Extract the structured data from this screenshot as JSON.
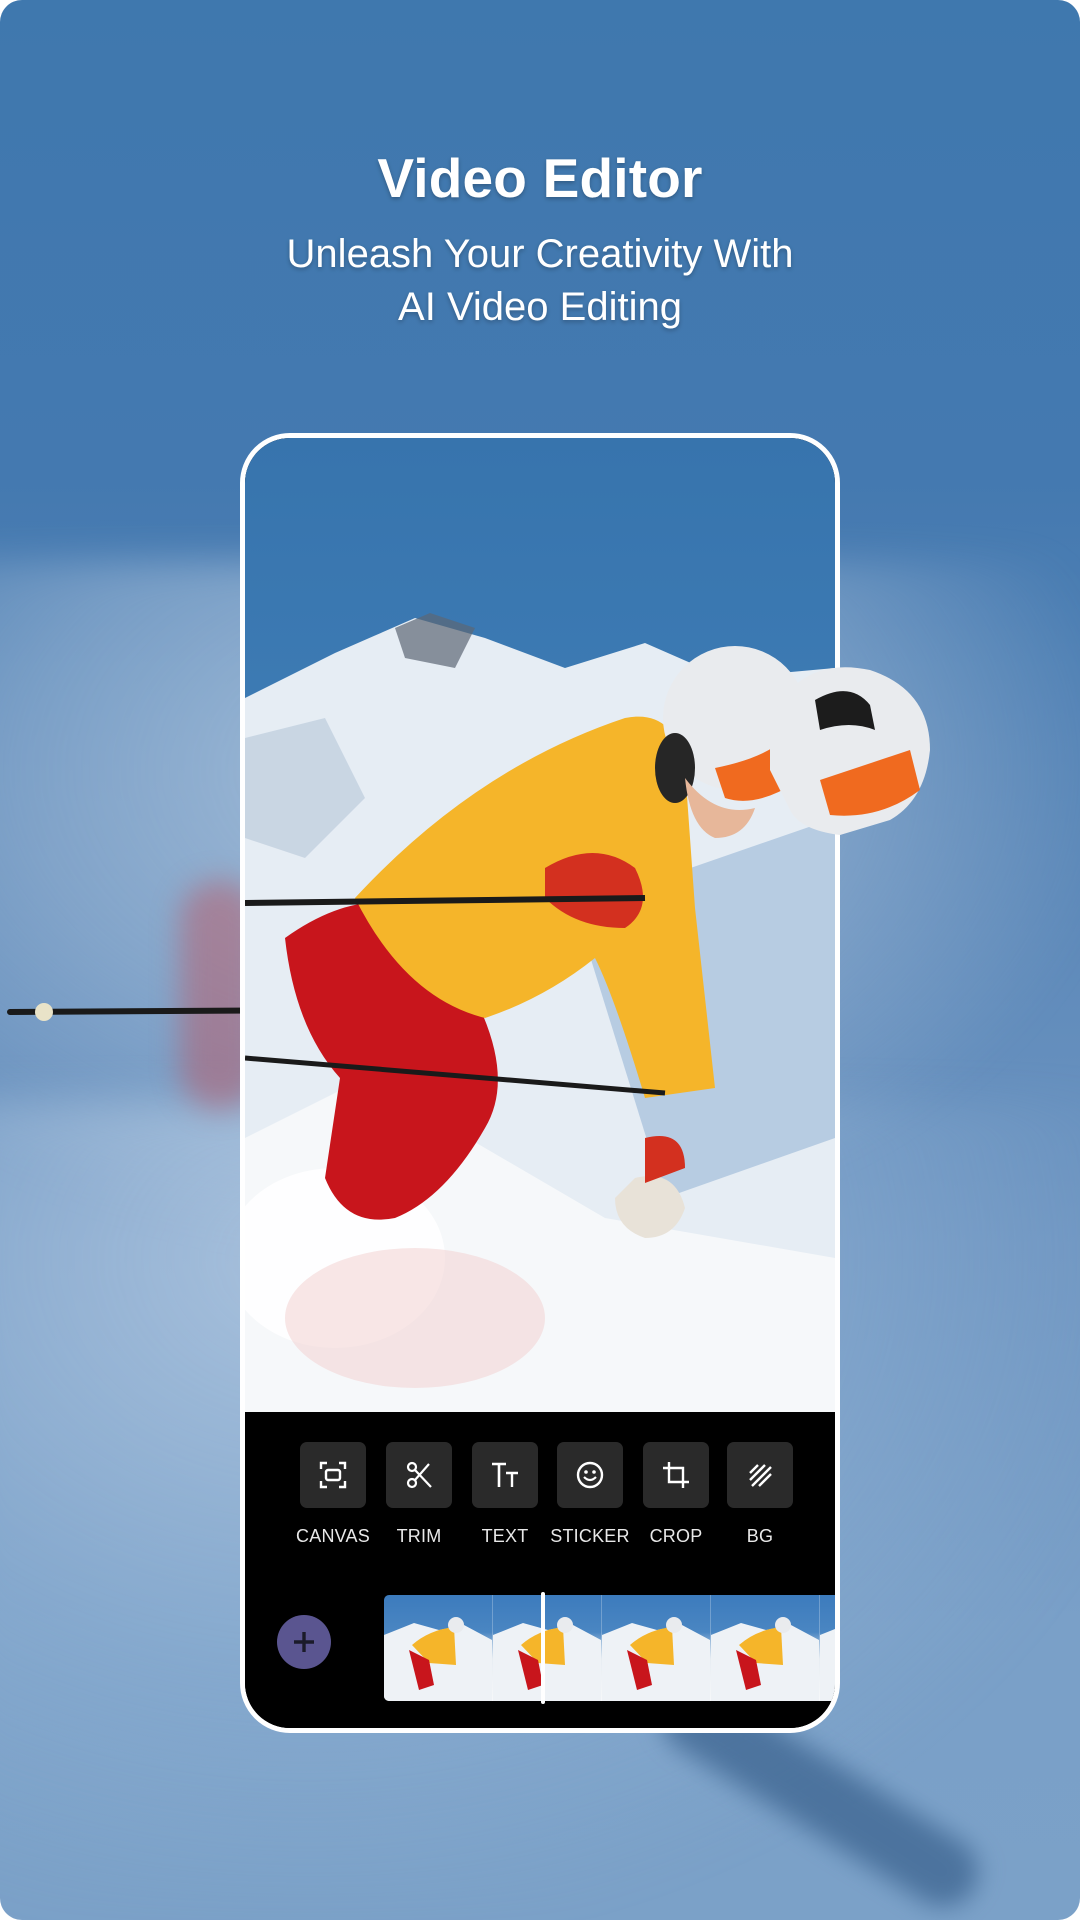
{
  "header": {
    "title": "Video Editor",
    "subtitle_line1": "Unleash Your Creativity With",
    "subtitle_line2": "AI Video Editing"
  },
  "editor": {
    "preview_subject": "skier in yellow jacket and red pants descending snowy slope",
    "tools": [
      {
        "label": "CANVAS",
        "icon": "canvas-icon"
      },
      {
        "label": "TRIM",
        "icon": "scissors-icon"
      },
      {
        "label": "TEXT",
        "icon": "text-size-icon"
      },
      {
        "label": "STICKER",
        "icon": "smiley-icon"
      },
      {
        "label": "CROP",
        "icon": "crop-icon"
      },
      {
        "label": "BG",
        "icon": "background-pattern-icon"
      }
    ],
    "add_clip_icon": "plus-icon",
    "timeline_frame_count": 5
  },
  "colors": {
    "background_blue": "#4479b0",
    "toolbar_bg": "#000000",
    "tool_button_bg": "#2a2a2a",
    "add_button": "#5a5590",
    "jacket_yellow": "#f5b52a",
    "pants_red": "#c8151c"
  }
}
